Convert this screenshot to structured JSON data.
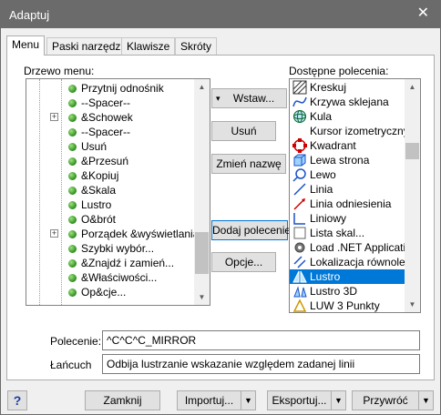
{
  "window": {
    "title": "Adaptuj",
    "close_icon": "close-icon"
  },
  "tabs": [
    {
      "label": "Menu",
      "active": true
    },
    {
      "label": "Paski narzędzi",
      "active": false
    },
    {
      "label": "Klawisze",
      "active": false
    },
    {
      "label": "Skróty",
      "active": false
    }
  ],
  "tree": {
    "label": "Drzewo menu:",
    "items": [
      "Przytnij odnośnik",
      "--Spacer--",
      "&Schowek",
      "--Spacer--",
      "Usuń",
      "&Przesuń",
      "&Kopiuj",
      "&Skala",
      "Lustro",
      "O&brót",
      "Porządek &wyświetlania...",
      "Szybki wybór...",
      "&Znajdź i zamień...",
      "&Właściwości...",
      "Op&cje..."
    ]
  },
  "middle_buttons": {
    "insert": "Wstaw...",
    "delete": "Usuń",
    "rename": "Zmień nazwę",
    "add_command": "Dodaj polecenie",
    "options": "Opcje..."
  },
  "commands": {
    "label": "Dostępne polecenia:",
    "selected": "Lustro",
    "items": [
      {
        "label": "Kreskuj",
        "icon": "hatch-icon"
      },
      {
        "label": "Krzywa sklejana",
        "icon": "spline-icon"
      },
      {
        "label": "Kula",
        "icon": "sphere-icon"
      },
      {
        "label": "Kursor izometryczny",
        "icon": ""
      },
      {
        "label": "Kwadrant",
        "icon": "quadrant-icon"
      },
      {
        "label": "Lewa strona",
        "icon": "left-view-icon"
      },
      {
        "label": "Lewo",
        "icon": "left-icon"
      },
      {
        "label": "Linia",
        "icon": "line-icon"
      },
      {
        "label": "Linia odniesienia",
        "icon": "leader-icon"
      },
      {
        "label": "Liniowy",
        "icon": "linear-dim-icon"
      },
      {
        "label": "Lista skal...",
        "icon": "scale-list-icon"
      },
      {
        "label": "Load .NET Application",
        "icon": "gear-icon"
      },
      {
        "label": "Lokalizacja równoległa",
        "icon": "parallel-icon"
      },
      {
        "label": "Lustro",
        "icon": "mirror-icon"
      },
      {
        "label": "Lustro 3D",
        "icon": "mirror3d-icon"
      },
      {
        "label": "LUW 3 Punkty",
        "icon": "ucs3p-icon"
      }
    ]
  },
  "fields": {
    "command_label": "Polecenie:",
    "command_value": "^C^C^C_MIRROR",
    "tooltip_label": "Łańcuch",
    "tooltip_value": "Odbija lustrzanie wskazanie względem zadanej linii"
  },
  "footer": {
    "help": "?",
    "close": "Zamknij",
    "import": "Importuj...",
    "export": "Eksportuj...",
    "restore": "Przywróć"
  }
}
